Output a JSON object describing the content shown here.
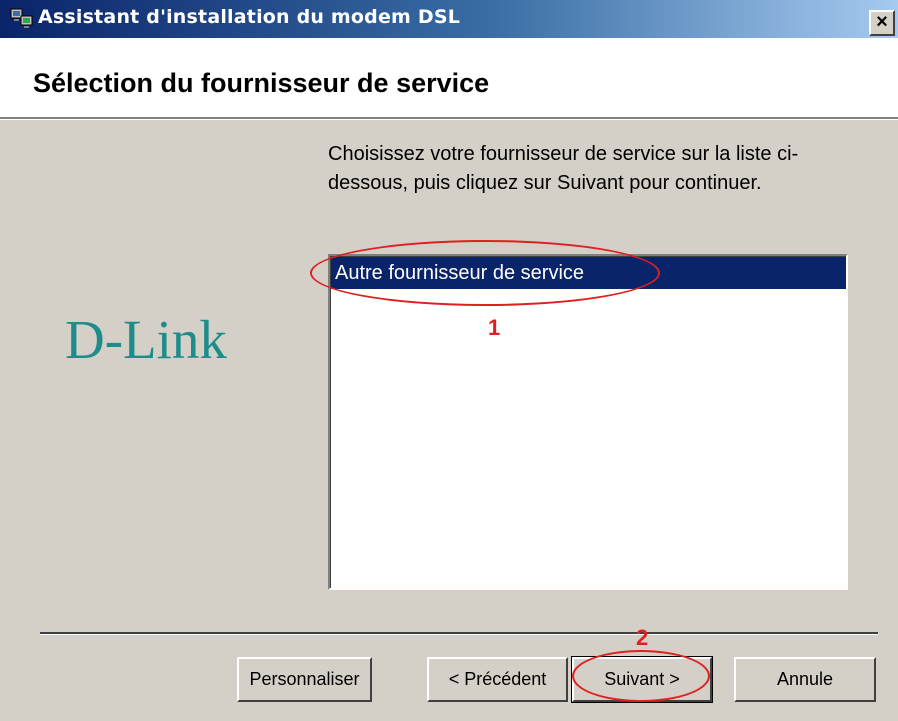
{
  "window": {
    "title": "Assistant d'installation du modem DSL",
    "close_label": "×",
    "icon": "network-computer-icon"
  },
  "header": {
    "title": "Sélection du fournisseur de service"
  },
  "main": {
    "instructions": "Choisissez votre fournisseur de service sur la liste ci-dessous, puis cliquez sur Suivant pour continuer.",
    "brand": "D-Link",
    "provider_list": {
      "items": [
        {
          "label": "Autre fournisseur de service",
          "selected": true
        }
      ]
    }
  },
  "footer": {
    "customize_label": "Personnaliser",
    "back_label": "< Précédent",
    "next_label": "Suivant >",
    "cancel_label": "Annule"
  },
  "annotations": {
    "step1": "1",
    "step2": "2",
    "color": "#e02020"
  }
}
